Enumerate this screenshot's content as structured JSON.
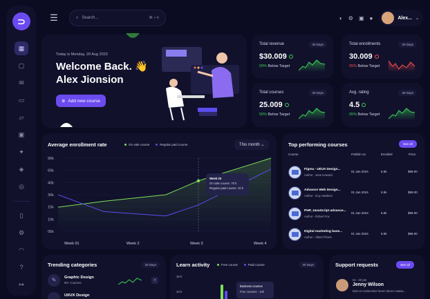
{
  "search": {
    "placeholder": "Search...",
    "shortcut": "⌘ + k"
  },
  "user": {
    "name": "Alex..."
  },
  "welcome": {
    "date": "Today is Monday, 20 Aug 2023",
    "greeting": "Welcome Back. 👋",
    "name": "Alex Jionsion",
    "button": "Add new course"
  },
  "stats": [
    {
      "label": "Total revenue",
      "period": "30 Days",
      "value": "$30.009",
      "change": "09% Below Target",
      "trend": "up",
      "color": "#39d353",
      "pct": "09%",
      "rest": " Below Target"
    },
    {
      "label": "Total enrollments",
      "period": "30 Days",
      "value": "30.009",
      "change": "05% Below Target",
      "trend": "down",
      "color": "#ff4d4d",
      "pct": "05%",
      "rest": " Below Target"
    },
    {
      "label": "Total courses",
      "period": "30 Days",
      "value": "25.009",
      "change": "50% Below Target",
      "trend": "up",
      "color": "#39d353",
      "pct": "50%",
      "rest": " Below Target"
    },
    {
      "label": "Avg. rating",
      "period": "30 Days",
      "value": "4.5",
      "change": "05% Below Target",
      "trend": "up",
      "color": "#39d353",
      "pct": "05%",
      "rest": " Below Target"
    }
  ],
  "enrollment": {
    "title": "Average enrollment rate",
    "legend": [
      "On sale course",
      "Regular paid course"
    ],
    "period": "This month",
    "tooltip": {
      "title": "Week 03",
      "line1": "On sale course: 70 k",
      "line2": "Regular paid course: 10 k"
    }
  },
  "chart_data": {
    "type": "line",
    "x": [
      "Week 01",
      "Week 2",
      "Week 3",
      "Week 4"
    ],
    "yticks": [
      "90k",
      "60k",
      "40k",
      "30k",
      "15k",
      "10k",
      "05k"
    ],
    "series": [
      {
        "name": "On sale course",
        "color": "#7ee05a",
        "values": [
          0.33,
          0.41,
          0.5,
          0.69,
          1.0
        ]
      },
      {
        "name": "Regular paid course",
        "color": "#5b4df0",
        "values": [
          0.5,
          0.27,
          0.21,
          0.36,
          0.85
        ]
      }
    ]
  },
  "top": {
    "title": "Top performing courses",
    "see_all": "See all",
    "headers": [
      "Course",
      "Publish on",
      "Enrolled",
      "Price"
    ],
    "rows": [
      {
        "name": "Figma - UI/UX Design...",
        "author": "Author - Jane Howard",
        "date": "01 Jan 2024",
        "enrolled": "5.5k",
        "price": "$99.00"
      },
      {
        "name": "Advance Web Design...",
        "author": "Author - Guy Hawkins",
        "date": "01 Jan 2024",
        "enrolled": "5.5k",
        "price": "$99.00"
      },
      {
        "name": "PHP, JavaScript advance...",
        "author": "Author - Robert Fox",
        "date": "01 Jan 2024",
        "enrolled": "5.5k",
        "price": "$99.00"
      },
      {
        "name": "Digital marketing base...",
        "author": "Author - Albert Flores",
        "date": "01 Jan 2024",
        "enrolled": "5.5k",
        "price": "$99.00"
      }
    ]
  },
  "trending": {
    "title": "Trending categories",
    "period": "30 Days",
    "items": [
      {
        "name": "Graphic Design",
        "count": "50+ Courses"
      },
      {
        "name": "UI/UX Design",
        "count": ""
      }
    ]
  },
  "learn": {
    "title": "Learn activity",
    "legend": [
      "Free course",
      "Paid course"
    ],
    "period": "30 Days",
    "yticks": [
      "15 k",
      "10 k"
    ],
    "tooltip_title": "Business courses",
    "tooltip_line": "Free courses - 10k"
  },
  "support": {
    "title": "Support requests",
    "see_all": "See all",
    "time": "01 : 20 pm",
    "name": "Jenny Wilson",
    "msg": "Duis et consectetur lorem donec massa..."
  }
}
